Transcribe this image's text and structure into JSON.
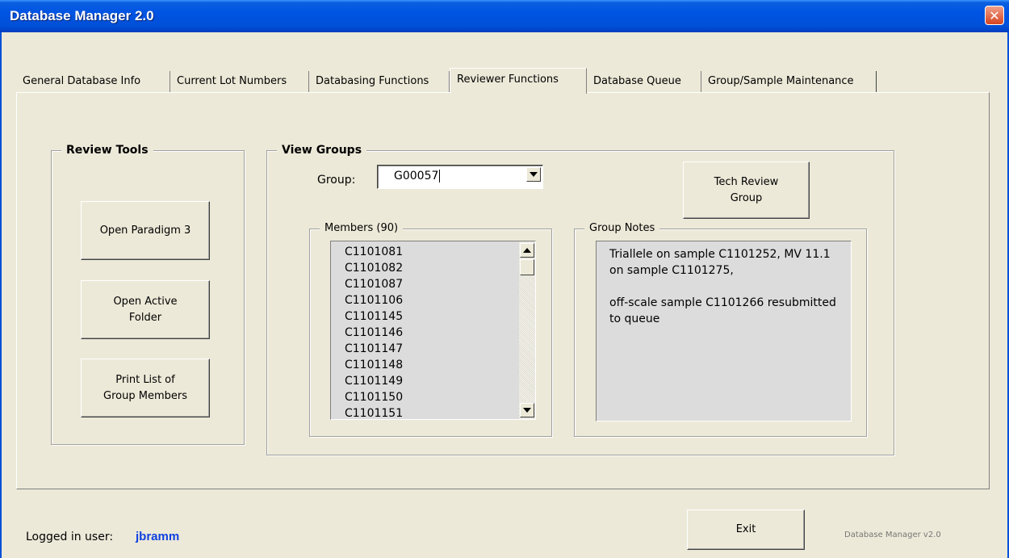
{
  "window": {
    "title": "Database Manager 2.0",
    "close_label": "✕"
  },
  "tabs": [
    {
      "label": "General Database Info"
    },
    {
      "label": "Current Lot Numbers"
    },
    {
      "label": "Databasing Functions"
    },
    {
      "label": "Reviewer Functions",
      "active": true
    },
    {
      "label": "Database Queue"
    },
    {
      "label": "Group/Sample Maintenance"
    }
  ],
  "review_tools": {
    "title": "Review Tools",
    "open_paradigm": "Open Paradigm 3",
    "open_active_folder": "Open Active\nFolder",
    "print_list": "Print List of\nGroup Members"
  },
  "view_groups": {
    "title": "View Groups",
    "group_label": "Group:",
    "group_value": "G00057",
    "tech_review": "Tech Review\nGroup",
    "members_title": "Members (90)",
    "members": [
      "C1101081",
      "C1101082",
      "C1101087",
      "C1101106",
      "C1101145",
      "C1101146",
      "C1101147",
      "C1101148",
      "C1101149",
      "C1101150",
      "C1101151"
    ],
    "notes_title": "Group Notes",
    "notes_text": "Triallele on sample C1101252, MV 11.1\non sample C1101275,\n\noff-scale sample C1101266 resubmitted\nto queue"
  },
  "footer": {
    "logged_in_label": "Logged in user:",
    "username": "jbramm",
    "exit_label": "Exit",
    "version_text": "Database Manager v2.0"
  },
  "colors": {
    "titlebar": "#0054e3",
    "face": "#ece9d8",
    "username": "#1040e0"
  }
}
